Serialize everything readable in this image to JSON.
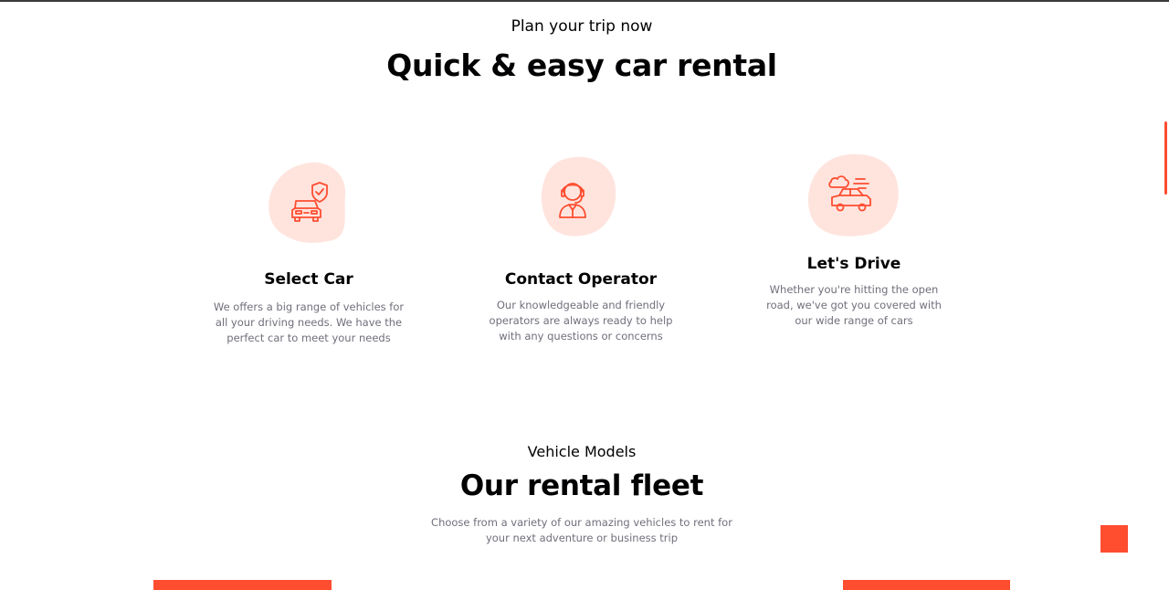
{
  "plan_section": {
    "eyebrow": "Plan your trip now",
    "heading": "Quick & easy car rental",
    "cards": [
      {
        "icon": "car-shield-icon",
        "title": "Select Car",
        "description": "We offers a big range of vehicles for all your driving needs. We have the perfect car to meet your needs"
      },
      {
        "icon": "operator-headset-icon",
        "title": "Contact Operator",
        "description": "Our knowledgeable and friendly operators are always ready to help with any questions or concerns"
      },
      {
        "icon": "driving-car-icon",
        "title": "Let's Drive",
        "description": "Whether you're hitting the open road, we've got you covered with our wide range of cars"
      }
    ]
  },
  "fleet_section": {
    "eyebrow": "Vehicle Models",
    "heading": "Our rental fleet",
    "description": "Choose from a variety of our amazing vehicles to rent for your next adventure or business trip"
  },
  "colors": {
    "accent": "#ff4d30",
    "blob": "#ffeae6",
    "heading": "#010103",
    "body_text": "#706f7b"
  }
}
